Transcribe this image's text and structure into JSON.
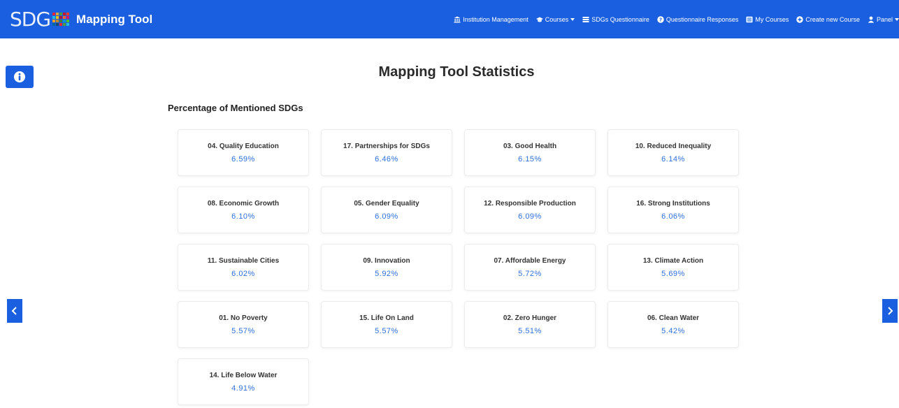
{
  "navbar": {
    "brand_logo_text": "SDG",
    "brand_title": "Mapping Tool",
    "links": [
      {
        "label": "Institution Management",
        "icon": "institution-icon",
        "dropdown": false
      },
      {
        "label": "Courses",
        "icon": "graduation-cap-icon",
        "dropdown": true
      },
      {
        "label": "SDGs Questionnaire",
        "icon": "list-icon",
        "dropdown": false
      },
      {
        "label": "Questionnaire Responses",
        "icon": "question-circle-icon",
        "dropdown": false
      },
      {
        "label": "My Courses",
        "icon": "courses-icon",
        "dropdown": false
      },
      {
        "label": "Create new Course",
        "icon": "plus-circle-icon",
        "dropdown": false
      },
      {
        "label": "Panel",
        "icon": "user-icon",
        "dropdown": true
      }
    ]
  },
  "page": {
    "title": "Mapping Tool Statistics",
    "section_title": "Percentage of Mentioned SDGs"
  },
  "sdgs": [
    {
      "label": "04. Quality Education",
      "value": "6.59%"
    },
    {
      "label": "17. Partnerships for SDGs",
      "value": "6.46%"
    },
    {
      "label": "03. Good Health",
      "value": "6.15%"
    },
    {
      "label": "10. Reduced Inequality",
      "value": "6.14%"
    },
    {
      "label": "08. Economic Growth",
      "value": "6.10%"
    },
    {
      "label": "05. Gender Equality",
      "value": "6.09%"
    },
    {
      "label": "12. Responsible Production",
      "value": "6.09%"
    },
    {
      "label": "16. Strong Institutions",
      "value": "6.06%"
    },
    {
      "label": "11. Sustainable Cities",
      "value": "6.02%"
    },
    {
      "label": "09. Innovation",
      "value": "5.92%"
    },
    {
      "label": "07. Affordable Energy",
      "value": "5.72%"
    },
    {
      "label": "13. Climate Action",
      "value": "5.69%"
    },
    {
      "label": "01. No Poverty",
      "value": "5.57%"
    },
    {
      "label": "15. Life On Land",
      "value": "5.57%"
    },
    {
      "label": "02. Zero Hunger",
      "value": "5.51%"
    },
    {
      "label": "06. Clean Water",
      "value": "5.42%"
    },
    {
      "label": "14. Life Below Water",
      "value": "4.91%"
    }
  ],
  "icons": {
    "info": "info-icon",
    "prev": "chevron-left-icon",
    "next": "chevron-right-icon"
  },
  "colors": {
    "navbar": "#1a5fe0",
    "accent_value": "#2f6fde",
    "logo_dots": [
      "#e5243b",
      "#dda63a",
      "#4c9f38",
      "#c5192d",
      "#ff3a21",
      "#26bde2",
      "#fcc30b",
      "#a21942",
      "#fd6925",
      "#dd1367",
      "#fd9d24",
      "#bf8b2e",
      "#3f7e44",
      "#0a97d9",
      "#56c02b",
      "#00689d",
      "#19486a",
      "#e5243b",
      "#4c9f38",
      "#26bde2"
    ]
  }
}
